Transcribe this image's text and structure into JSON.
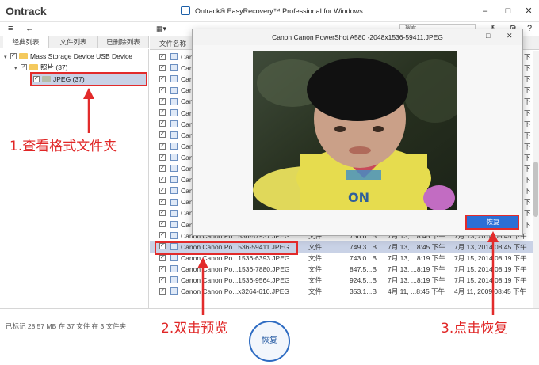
{
  "window": {
    "logo": "Ontrack",
    "title": "Ontrack® EasyRecovery™ Professional for Windows",
    "minimize": "–",
    "maximize": "□",
    "close": "✕"
  },
  "toolbar": {
    "menu_icon": "≡",
    "back_icon": "←",
    "search_placeholder": "搜索",
    "icons": [
      "key-icon",
      "gear-icon",
      "help-icon"
    ]
  },
  "left_pane": {
    "tabs": [
      {
        "label": "经典列表"
      },
      {
        "label": "文件列表"
      },
      {
        "label": "已删除列表"
      }
    ],
    "tree": [
      {
        "label": "Mass Storage Device USB Device"
      },
      {
        "label": "照片 (37)"
      },
      {
        "label": "JPEG (37)"
      }
    ]
  },
  "file_list": {
    "header": {
      "name": "文件名称"
    },
    "visible_rows_hidden": [
      "Cand",
      "Cand",
      "Cand",
      "Cand",
      "Cand",
      "Cand",
      "Cand",
      "Cand",
      "Cand",
      "Cand",
      "Cand",
      "Cand",
      "Cand",
      "Cand",
      "Cand",
      "Cand"
    ],
    "rows": [
      {
        "name": "Canon Canon Po...536-57937.JPEG",
        "type": "文件",
        "size": "736.6...B",
        "created": "7月 13, ...8:45 下午",
        "modified": "7月 13, 2014 08:45 下午"
      },
      {
        "name": "Canon Canon Po...536-59411.JPEG",
        "type": "文件",
        "size": "749.3...B",
        "created": "7月 13, ...8:45 下午",
        "modified": "7月 13, 2014 08:45 下午"
      },
      {
        "name": "Canon Canon Po...1536-6393.JPEG",
        "type": "文件",
        "size": "743.0...B",
        "created": "7月 13, ...8:19 下午",
        "modified": "7月 15, 2014 08:19 下午"
      },
      {
        "name": "Canon Canon Po...1536-7880.JPEG",
        "type": "文件",
        "size": "847.5...B",
        "created": "7月 13, ...8:19 下午",
        "modified": "7月 15, 2014 08:19 下午"
      },
      {
        "name": "Canon Canon Po...1536-9564.JPEG",
        "type": "文件",
        "size": "924.5...B",
        "created": "7月 13, ...8:19 下午",
        "modified": "7月 15, 2014 08:19 下午"
      },
      {
        "name": "Canon Canon Po...x3264-610.JPEG",
        "type": "文件",
        "size": "353.1...B",
        "created": "4月 11, ...8:45 下午",
        "modified": "4月 11, 2009 08:45 下午"
      }
    ],
    "right_edge_col": [
      "下",
      "下",
      "下",
      "下",
      "下",
      "下",
      "下",
      "下",
      "下",
      "下",
      "下",
      "下",
      "下",
      "下",
      "下",
      "下",
      "下",
      "下",
      "下",
      "下",
      "下",
      "下"
    ]
  },
  "footer": {
    "status": "已标记 28.57 MB 在 37 文件 在 3 文件夹",
    "recover_label": "恢复"
  },
  "preview_dialog": {
    "title": "Canon Canon PowerShot A580 -2048x1536-59411.JPEG",
    "recover_label": "恢复"
  },
  "annotations": {
    "step1": "1.查看格式文件夹",
    "step2": "2.双击预览",
    "step3": "3.点击恢复",
    "color": "#e02626"
  }
}
